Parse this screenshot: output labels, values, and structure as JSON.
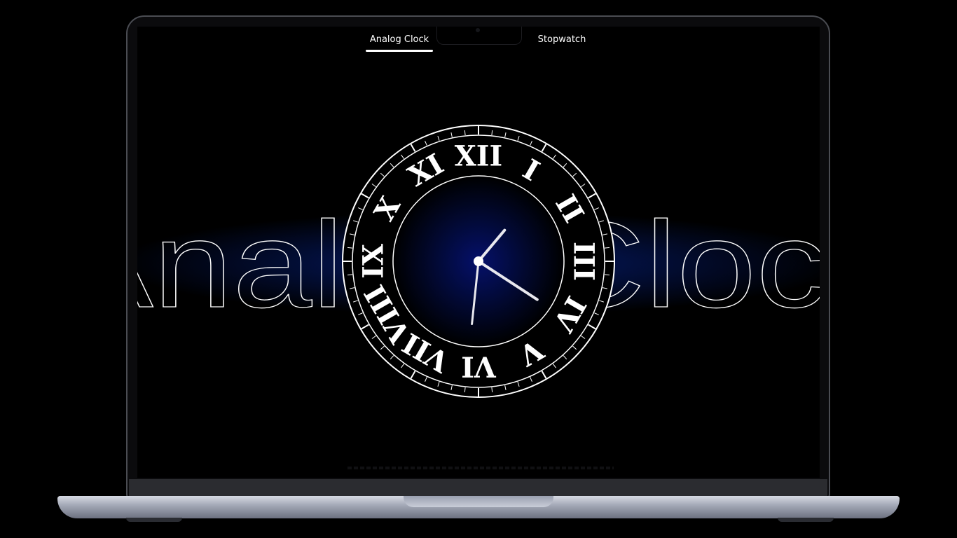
{
  "nav": {
    "tabs": [
      {
        "label": "Analog Clock",
        "active": true
      },
      {
        "label": "",
        "active": false
      },
      {
        "label": "Stopwatch",
        "active": false
      }
    ]
  },
  "hero": {
    "title": "Analog Clock"
  },
  "clock": {
    "numerals": [
      "XII",
      "I",
      "II",
      "III",
      "IV",
      "V",
      "VI",
      "VII",
      "VIII",
      "IX",
      "X",
      "XI"
    ],
    "time": {
      "hour": 1,
      "minute": 20,
      "second": 31
    },
    "face_glow_color": "#05106a",
    "ink_color": "#ffffff"
  },
  "colors": {
    "background": "#000000",
    "band_glow": "#05105a",
    "laptop_base": "#a5aab8"
  }
}
